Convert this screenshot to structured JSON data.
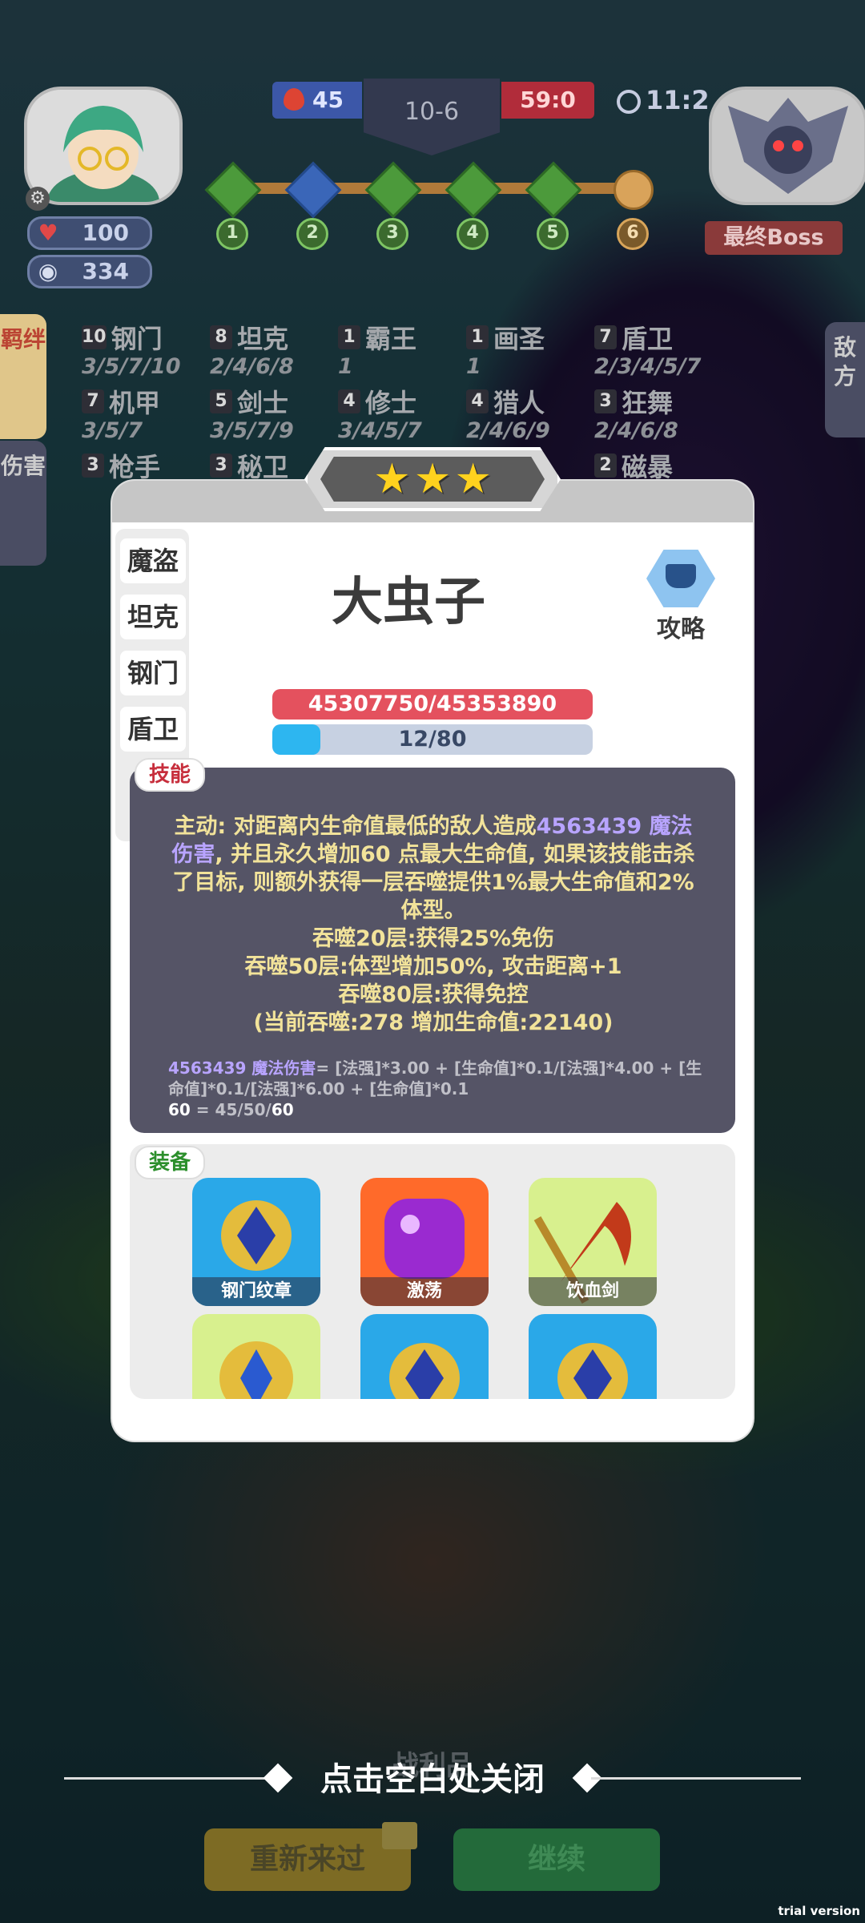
{
  "hud": {
    "player_hp": "100",
    "player_gold": "334",
    "left_score": "45",
    "stage": "10-6",
    "right_score": "59:0",
    "timer": "11:2",
    "route_nodes": [
      "1",
      "2",
      "3",
      "4",
      "5",
      "6"
    ],
    "boss_label": "最终Boss"
  },
  "side_tabs": {
    "synergy": "羁绊",
    "damage": "伤害",
    "enemy": "敌方"
  },
  "synergies": [
    {
      "level": "10",
      "name": "钢门",
      "stages": "3/5/7/10"
    },
    {
      "level": "8",
      "name": "坦克",
      "stages": "2/4/6/8"
    },
    {
      "level": "1",
      "name": "霸王",
      "stages": "1"
    },
    {
      "level": "1",
      "name": "画圣",
      "stages": "1"
    },
    {
      "level": "7",
      "name": "盾卫",
      "stages": "2/3/4/5/7"
    },
    {
      "level": "7",
      "name": "机甲",
      "stages": "3/5/7"
    },
    {
      "level": "5",
      "name": "剑士",
      "stages": "3/5/7/9"
    },
    {
      "level": "4",
      "name": "修士",
      "stages": "3/4/5/7"
    },
    {
      "level": "4",
      "name": "猎人",
      "stages": "2/4/6/9"
    },
    {
      "level": "3",
      "name": "狂舞",
      "stages": "2/4/6/8"
    },
    {
      "level": "3",
      "name": "枪手",
      "stages": ""
    },
    {
      "level": "3",
      "name": "秘卫",
      "stages": ""
    },
    {
      "level": "2",
      "name": "磁暴",
      "stages": ""
    }
  ],
  "unit": {
    "stars": 3,
    "name": "大虫子",
    "guide_label": "攻略",
    "tags": [
      "魔盗",
      "坦克",
      "钢门",
      "盾卫"
    ],
    "hp_text": "45307750/45353890",
    "hp_ratio": 0.999,
    "mana_text": "12/80",
    "mana_ratio": 0.15
  },
  "skill": {
    "tag": "技能",
    "line1_prefix": "主动: 对距离内生命值最低的敌人造成",
    "line1_damage": "4563439 魔法伤害",
    "line1_rest": ", 并且永久增加60 点最大生命值, 如果该技能击杀了目标, 则额外获得一层吞噬提供1%最大生命值和2%体型。",
    "line2": "吞噬20层:获得25%免伤",
    "line3": "吞噬50层:体型增加50%, 攻击距离+1",
    "line4": "吞噬80层:获得免控",
    "line5": "(当前吞噬:278 增加生命值:22140)",
    "formula1_value": "4563439 魔法伤害",
    "formula1_body": "= [法强]*3.00 + [生命值]*0.1/[法强]*4.00 + [生命值]*0.1/[法强]*6.00 + [生命值]*0.1",
    "formula2_value": "60",
    "formula2_body": " = 45/50/",
    "formula2_current": "60"
  },
  "equipment": {
    "tag": "装备",
    "items": [
      {
        "name": "钢门纹章",
        "color": "#2aa8e8"
      },
      {
        "name": "激荡",
        "color": "#ff6a2a"
      },
      {
        "name": "饮血剑",
        "color": "#d8f08e"
      },
      {
        "name": "",
        "color": "#d8f08e"
      },
      {
        "name": "",
        "color": "#2aa8e8"
      },
      {
        "name": "",
        "color": "#2aa8e8"
      }
    ]
  },
  "bottom": {
    "spoils": "战利品",
    "close_hint": "点击空白处关闭",
    "retry": "重新来过",
    "continue": "继续"
  },
  "watermark": "trial version"
}
